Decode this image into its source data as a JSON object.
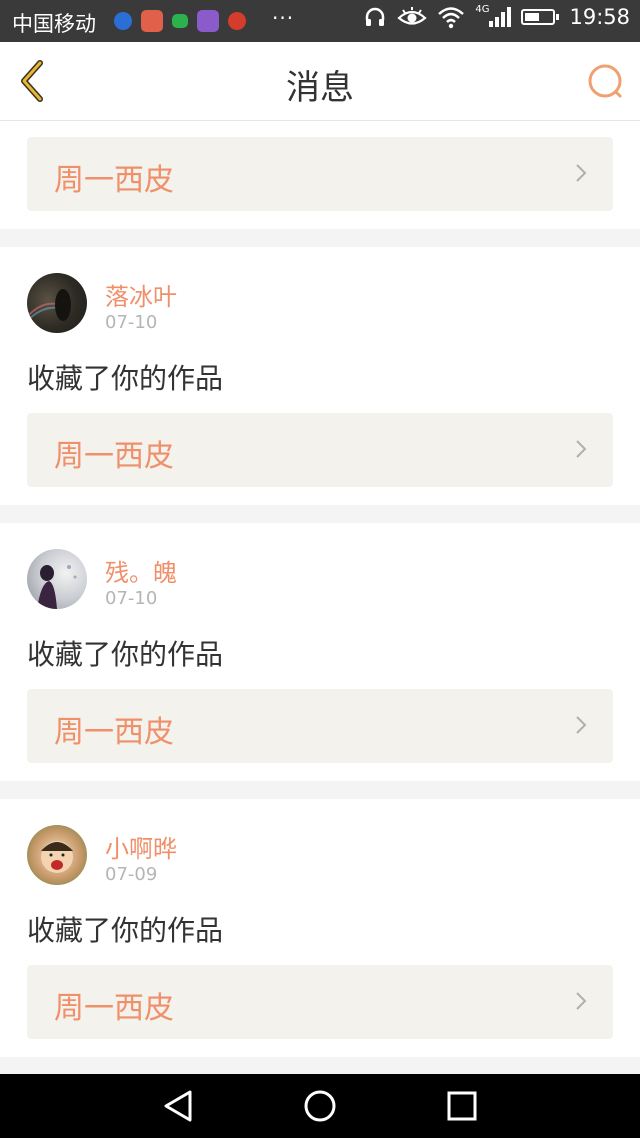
{
  "status_bar": {
    "carrier": "中国移动",
    "network_type": "4G",
    "time": "19:58",
    "notification_icons": [
      "app-k-icon",
      "app-sad-icon",
      "app-chat-icon",
      "app-gallery-icon",
      "app-weibo-icon"
    ],
    "battery_level": 0.55,
    "accent": "#3a3a3a"
  },
  "header": {
    "title": "消息",
    "back_icon": "chevron-left-icon",
    "search_icon": "search-icon"
  },
  "colors": {
    "accent_orange": "#f0906a",
    "back_yellow": "#e7b733",
    "work_box_bg": "#f3f2ec"
  },
  "first_item": {
    "work_title": "周一西皮"
  },
  "messages": [
    {
      "username": "落冰叶",
      "date": "07-10",
      "text": "收藏了你的作品",
      "work_title": "周一西皮"
    },
    {
      "username": "残。魄",
      "date": "07-10",
      "text": "收藏了你的作品",
      "work_title": "周一西皮"
    },
    {
      "username": "小啊晔",
      "date": "07-09",
      "text": "收藏了你的作品",
      "work_title": "周一西皮"
    }
  ],
  "nav_bar": {
    "buttons": [
      "back-triangle-icon",
      "home-circle-icon",
      "recents-square-icon"
    ]
  }
}
